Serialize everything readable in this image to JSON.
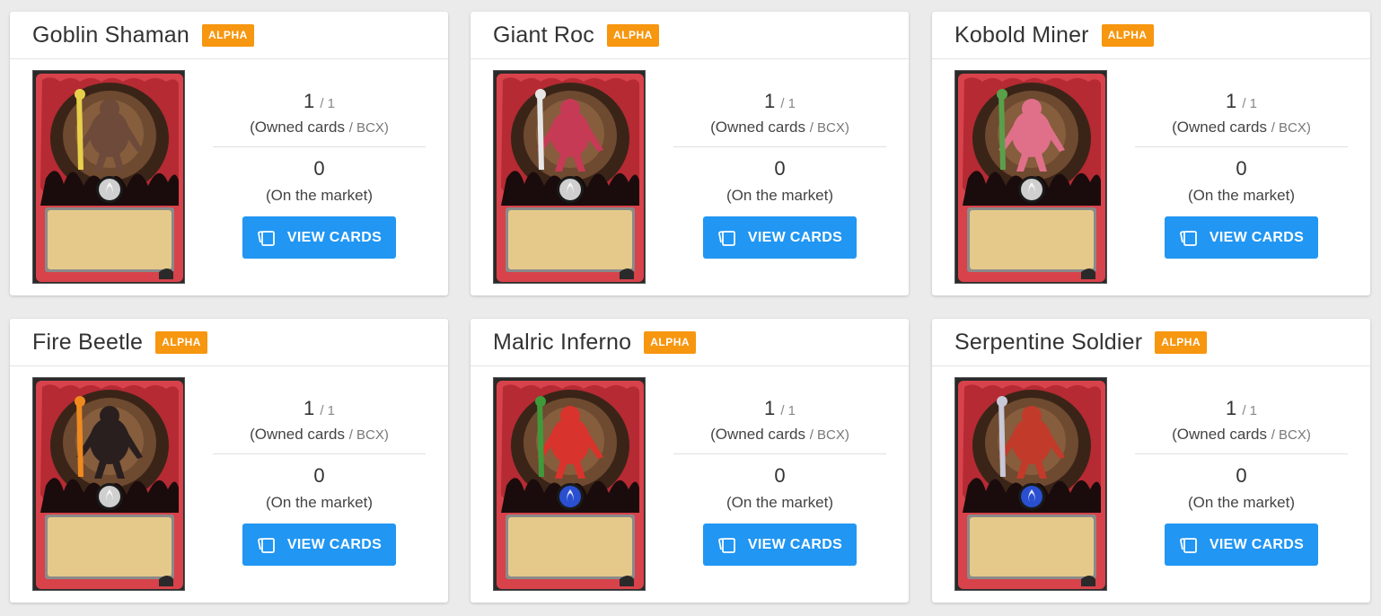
{
  "cards": [
    {
      "name": "Goblin Shaman",
      "edition": "ALPHA",
      "owned": "1",
      "bcx": "/ 1",
      "owned_label_a": "(Owned cards",
      "owned_label_b": "/ BCX)",
      "market": "0",
      "market_label": "(On the market)",
      "button": "VIEW CARDS",
      "art_colors": {
        "creature": "#6d4a3a",
        "accent": "#e8d04a",
        "orb": "#cfcfcf"
      }
    },
    {
      "name": "Giant Roc",
      "edition": "ALPHA",
      "owned": "1",
      "bcx": "/ 1",
      "owned_label_a": "(Owned cards",
      "owned_label_b": "/ BCX)",
      "market": "0",
      "market_label": "(On the market)",
      "button": "VIEW CARDS",
      "art_colors": {
        "creature": "#c63a55",
        "accent": "#e6e6e6",
        "orb": "#cfcfcf"
      }
    },
    {
      "name": "Kobold Miner",
      "edition": "ALPHA",
      "owned": "1",
      "bcx": "/ 1",
      "owned_label_a": "(Owned cards",
      "owned_label_b": "/ BCX)",
      "market": "0",
      "market_label": "(On the market)",
      "button": "VIEW CARDS",
      "art_colors": {
        "creature": "#e0708a",
        "accent": "#5aa04a",
        "orb": "#cfcfcf"
      }
    },
    {
      "name": "Fire Beetle",
      "edition": "ALPHA",
      "owned": "1",
      "bcx": "/ 1",
      "owned_label_a": "(Owned cards",
      "owned_label_b": "/ BCX)",
      "market": "0",
      "market_label": "(On the market)",
      "button": "VIEW CARDS",
      "art_colors": {
        "creature": "#2a1f1f",
        "accent": "#f08a1e",
        "orb": "#cfcfcf"
      }
    },
    {
      "name": "Malric Inferno",
      "edition": "ALPHA",
      "owned": "1",
      "bcx": "/ 1",
      "owned_label_a": "(Owned cards",
      "owned_label_b": "/ BCX)",
      "market": "0",
      "market_label": "(On the market)",
      "button": "VIEW CARDS",
      "art_colors": {
        "creature": "#d8332c",
        "accent": "#3f9a3a",
        "orb": "#2a4fd0"
      }
    },
    {
      "name": "Serpentine Soldier",
      "edition": "ALPHA",
      "owned": "1",
      "bcx": "/ 1",
      "owned_label_a": "(Owned cards",
      "owned_label_b": "/ BCX)",
      "market": "0",
      "market_label": "(On the market)",
      "button": "VIEW CARDS",
      "art_colors": {
        "creature": "#c23a2a",
        "accent": "#c8c8d8",
        "orb": "#2a4fd0"
      }
    }
  ],
  "colors": {
    "badge": "#f7960f",
    "button": "#2196f3",
    "card_frame": "#d8424a",
    "card_textbox": "#e4c98a"
  },
  "icons": {
    "button_icon": "cards-stack-icon",
    "orb_icon": "neutral-flame-orb-icon"
  }
}
